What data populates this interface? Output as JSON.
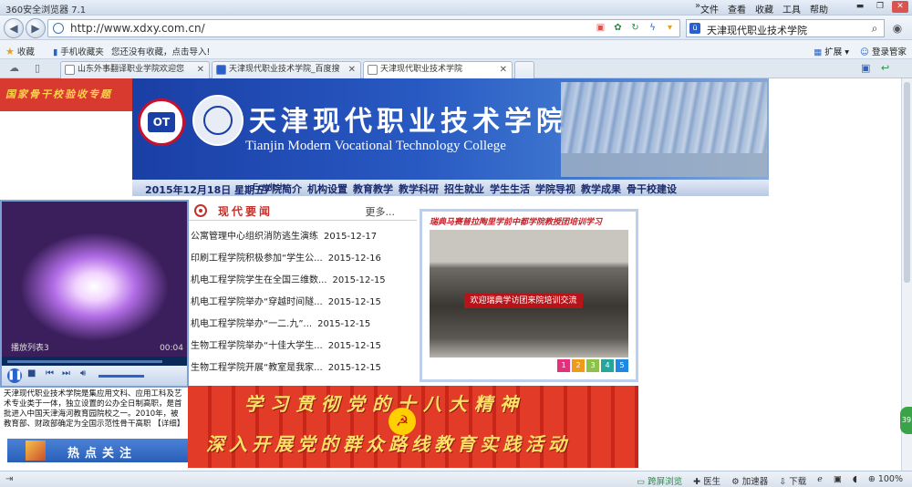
{
  "browser": {
    "title": "360安全浏览器 7.1",
    "menus": [
      "文件",
      "查看",
      "收藏",
      "工具",
      "帮助"
    ],
    "url": "http://www.xdxy.com.cn/",
    "search_query": "天津现代职业技术学院"
  },
  "favbar": {
    "favorites_label": "收藏",
    "mobile_favorites": "手机收藏夹",
    "hint": "您还没有收藏，点击导入!",
    "extensions": "扩展",
    "login_favorites": "登录管家"
  },
  "tabs": [
    {
      "label": "山东外事翻译职业学院欢迎您"
    },
    {
      "label": "天津现代职业技术学院_百度搜"
    },
    {
      "label": "天津现代职业技术学院"
    }
  ],
  "page": {
    "badge": "国家骨干校验收专题",
    "school_cn": "天津现代职业技术学院",
    "school_en": "Tianjin Modern Vocational Technology College",
    "logo_text": "OT",
    "date": "2015年12月18日  星期五",
    "english_link": "English",
    "nav": [
      "学院简介",
      "机构设置",
      "教育教学",
      "教学科研",
      "招生就业",
      "学生生活",
      "学院导视",
      "教学成果",
      "骨干校建设"
    ],
    "video": {
      "label": "播放列表3",
      "time": "00:04"
    },
    "intro": "天津现代职业技术学院是集应用文科、应用工科及艺术专业类于一体，独立设置的公办全日制高职，是首批进入中国天津海河教育园院校之一。2010年，被教育部、财政部确定为全国示范性骨干高职",
    "intro_more": "【详细】",
    "hot_title": "热点关注",
    "news_title": "现代要闻",
    "news_more": "更多...",
    "news": [
      {
        "title": "公寓管理中心组织消防逃生演练",
        "date": "2015-12-17"
      },
      {
        "title": "印刷工程学院积极参加“学生公...",
        "date": "2015-12-16"
      },
      {
        "title": "机电工程学院学生在全国三维数...",
        "date": "2015-12-15"
      },
      {
        "title": "机电工程学院举办“穿越时间隧...",
        "date": "2015-12-15"
      },
      {
        "title": "机电工程学院举办“一二.九”...",
        "date": "2015-12-15"
      },
      {
        "title": "生物工程学院举办“十佳大学生...",
        "date": "2015-12-15"
      },
      {
        "title": "生物工程学院开展“教室是我家...",
        "date": "2015-12-15"
      }
    ],
    "slide_caption": "瑞典马赛普拉陶里学前中都学院教授团培训学习",
    "slide_banner": "欢迎瑞典学访团来院培训交流",
    "slide_dots": [
      "1",
      "2",
      "3",
      "4",
      "5"
    ],
    "party_line1": "学习贯彻党的十八大精神",
    "party_line2": "深入开展党的群众路线教育实践活动"
  },
  "statusbar": {
    "items": [
      "跨屏浏览",
      "医生",
      "加速器",
      "下载",
      "100%"
    ],
    "bubble": "39"
  },
  "colors": {
    "banner_blue": "#2859c2",
    "party_red": "#e23b27",
    "news_red": "#c4312b"
  }
}
